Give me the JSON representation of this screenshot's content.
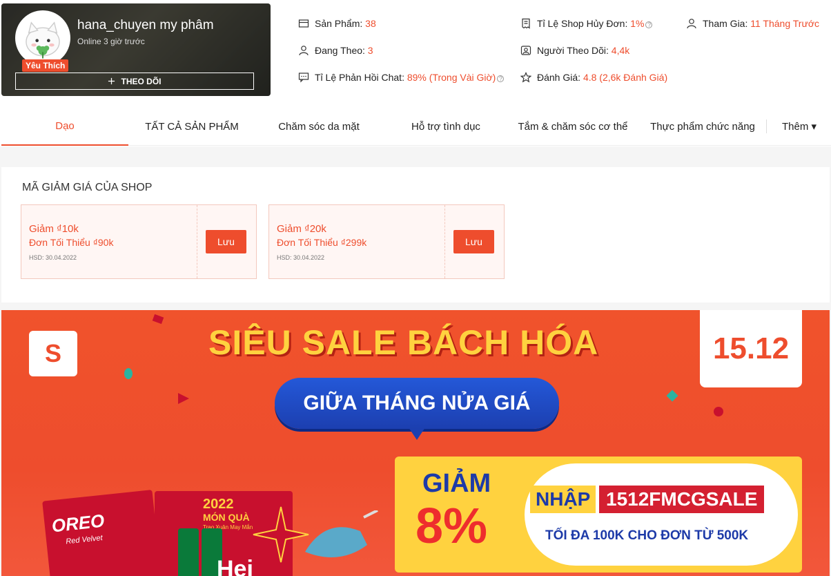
{
  "shop": {
    "name": "hana_chuyen my phâm",
    "online": "Online 3 giờ trước",
    "badge": "Yêu Thích",
    "follow_label": "THEO DÕI"
  },
  "stats": {
    "products_label": "Sản Phẩm:",
    "products_value": "38",
    "following_label": "Đang Theo:",
    "following_value": "3",
    "chat_label": "Tỉ Lệ Phản Hồi Chat:",
    "chat_value": "89% (Trong Vài Giờ)",
    "cancel_label": "Tỉ Lệ Shop Hủy Đơn:",
    "cancel_value": "1%",
    "followers_label": "Người Theo Dõi:",
    "followers_value": "4,4k",
    "rating_label": "Đánh Giá:",
    "rating_value": "4.8 (2,6k Đánh Giá)",
    "joined_label": "Tham Gia:",
    "joined_value": "11 Tháng Trước",
    "help_glyph": "?"
  },
  "tabs": [
    {
      "label": "Dạo",
      "active": true
    },
    {
      "label": "TẤT CẢ SẢN PHẨM",
      "active": false
    },
    {
      "label": "Chăm sóc da mặt",
      "active": false
    },
    {
      "label": "Hỗ trợ tình dục",
      "active": false
    },
    {
      "label": "Tắm & chăm sóc cơ thể",
      "active": false
    },
    {
      "label": "Thực phẩm chức năng",
      "active": false
    },
    {
      "label": "Thêm ▾",
      "active": false
    }
  ],
  "vouchers": {
    "title": "MÃ GIẢM GIÁ CỦA SHOP",
    "items": [
      {
        "discount": "Giảm ₫10k",
        "min": "Đơn Tối Thiểu ₫90k",
        "expiry": "HSD: 30.04.2022",
        "save": "Lưu"
      },
      {
        "discount": "Giảm ₫20k",
        "min": "Đơn Tối Thiểu ₫299k",
        "expiry": "HSD: 30.04.2022",
        "save": "Lưu"
      }
    ]
  },
  "banner": {
    "logo_letter": "S",
    "headline": "SIÊU SALE BÁCH HÓA",
    "date": "15.12",
    "subline": "GIỮA THÁNG NỬA GIÁ",
    "giam": "GIẢM",
    "percent": "8%",
    "nhap": "NHẬP",
    "code": "1512FMCGSALE",
    "condition": "TỐI ĐA 100K CHO ĐƠN TỪ 500K",
    "oreo": "OREO",
    "red_velvet": "Red Velvet",
    "year": "2022",
    "mon_qua": "MÓN QUÀ",
    "trao_xuan": "Trao Xuân May Mắn",
    "heineken": "Hei"
  },
  "colors": {
    "accent": "#ee4d2d",
    "promo_yellow": "#ffd23f",
    "promo_blue": "#1d3aa8"
  }
}
